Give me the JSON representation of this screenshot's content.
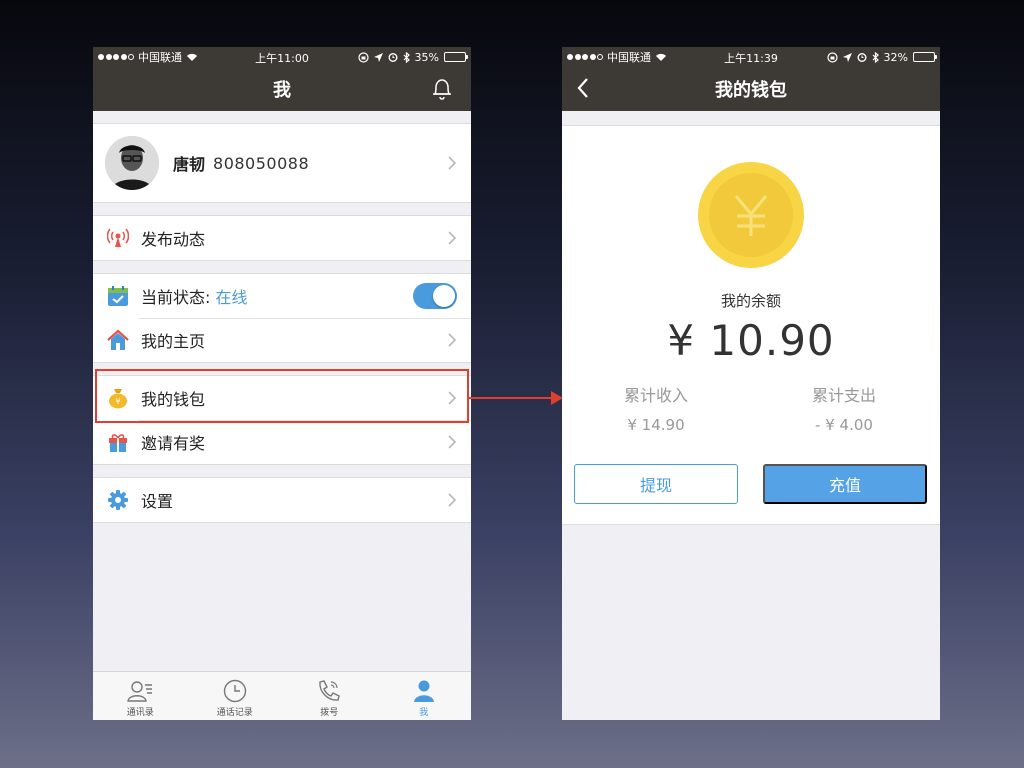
{
  "colors": {
    "accent": "#4a9bdd",
    "nav_bg": "#3d3935",
    "highlight": "#e23e2e",
    "coin": "#f7d544"
  },
  "left_screen": {
    "status_bar": {
      "carrier": "中国联通",
      "time": "上午11:00",
      "battery": "35%",
      "battery_level": 0.35
    },
    "nav": {
      "title": "我",
      "right_icon": "bell-icon"
    },
    "profile": {
      "name": "唐韧",
      "id": "808050088"
    },
    "menu": {
      "publish": {
        "label": "发布动态",
        "icon": "broadcast-icon"
      },
      "status": {
        "label": "当前状态: ",
        "value": "在线",
        "toggle_on": true,
        "icon": "calendar-check-icon"
      },
      "homepage": {
        "label": "我的主页",
        "icon": "home-icon"
      },
      "wallet": {
        "label": "我的钱包",
        "icon": "money-bag-icon"
      },
      "invite": {
        "label": "邀请有奖",
        "icon": "gift-icon"
      },
      "settings": {
        "label": "设置",
        "icon": "gear-icon"
      }
    },
    "tabs": [
      {
        "label": "通讯录",
        "icon": "contacts-icon"
      },
      {
        "label": "通话记录",
        "icon": "clock-icon"
      },
      {
        "label": "拨号",
        "icon": "phone-icon"
      },
      {
        "label": "我",
        "icon": "person-icon",
        "active": true
      }
    ]
  },
  "right_screen": {
    "status_bar": {
      "carrier": "中国联通",
      "time": "上午11:39",
      "battery": "32%",
      "battery_level": 0.32
    },
    "nav": {
      "title": "我的钱包",
      "left_icon": "back-chevron-icon"
    },
    "wallet": {
      "coin_symbol": "¥",
      "balance_label": "我的余额",
      "balance": "¥ 10.90",
      "income_label": "累计收入",
      "income_value": "¥ 14.90",
      "expense_label": "累计支出",
      "expense_value": "- ¥ 4.00",
      "withdraw_label": "提现",
      "recharge_label": "充值"
    }
  }
}
